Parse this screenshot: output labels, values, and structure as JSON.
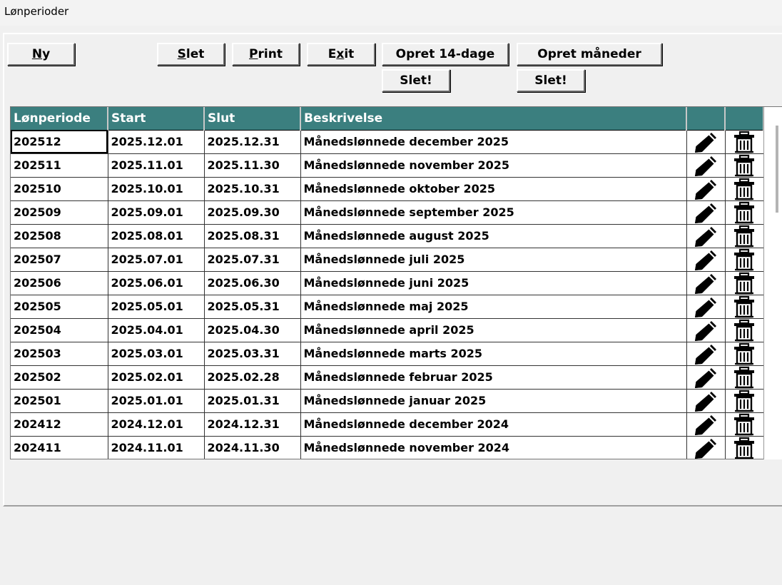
{
  "window": {
    "title": "Lønperioder"
  },
  "toolbar": {
    "ny": {
      "key": "N",
      "rest": "y"
    },
    "slet": {
      "key": "S",
      "rest": "let"
    },
    "print": {
      "key": "P",
      "rest": "rint"
    },
    "exit": {
      "pre": "E",
      "key": "x",
      "rest": "it"
    },
    "opret14": "Opret 14-dage",
    "opretmaaned": "Opret måneder",
    "slet14": "Slet!",
    "sletmaaned": "Slet!"
  },
  "table": {
    "headers": [
      "Lønperiode",
      "Start",
      "Slut",
      "Beskrivelse",
      "",
      ""
    ],
    "rows": [
      [
        "202512",
        "2025.12.01",
        "2025.12.31",
        "Månedslønnede december 2025"
      ],
      [
        "202511",
        "2025.11.01",
        "2025.11.30",
        "Månedslønnede november 2025"
      ],
      [
        "202510",
        "2025.10.01",
        "2025.10.31",
        "Månedslønnede oktober 2025"
      ],
      [
        "202509",
        "2025.09.01",
        "2025.09.30",
        "Månedslønnede september 2025"
      ],
      [
        "202508",
        "2025.08.01",
        "2025.08.31",
        "Månedslønnede august 2025"
      ],
      [
        "202507",
        "2025.07.01",
        "2025.07.31",
        "Månedslønnede juli 2025"
      ],
      [
        "202506",
        "2025.06.01",
        "2025.06.30",
        "Månedslønnede juni 2025"
      ],
      [
        "202505",
        "2025.05.01",
        "2025.05.31",
        "Månedslønnede maj 2025"
      ],
      [
        "202504",
        "2025.04.01",
        "2025.04.30",
        "Månedslønnede april 2025"
      ],
      [
        "202503",
        "2025.03.01",
        "2025.03.31",
        "Månedslønnede marts 2025"
      ],
      [
        "202502",
        "2025.02.01",
        "2025.02.28",
        "Månedslønnede februar 2025"
      ],
      [
        "202501",
        "2025.01.01",
        "2025.01.31",
        "Månedslønnede januar 2025"
      ],
      [
        "202412",
        "2024.12.01",
        "2024.12.31",
        "Månedslønnede december 2024"
      ],
      [
        "202411",
        "2024.11.01",
        "2024.11.30",
        "Månedslønnede november 2024"
      ]
    ],
    "row_icons": [
      "pencil-icon",
      "trash-icon"
    ],
    "header_color": "#3b7f7f"
  }
}
